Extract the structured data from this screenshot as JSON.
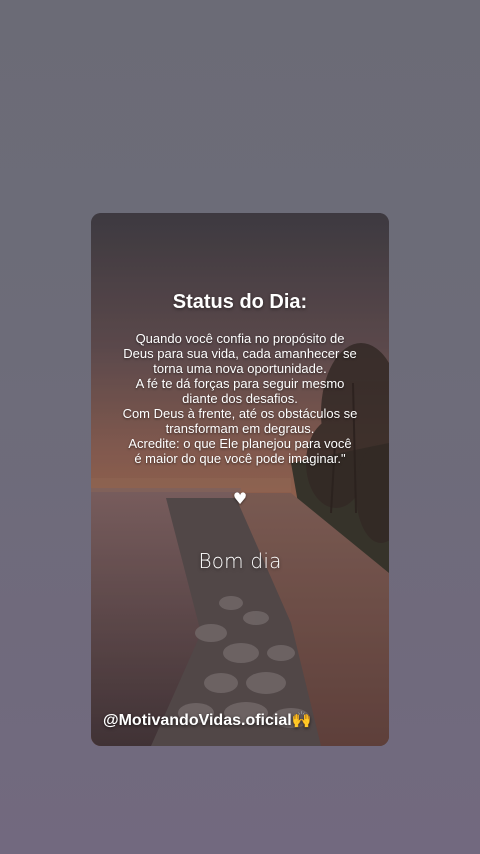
{
  "status_card": {
    "title": "Status do Dia:",
    "message_lines": [
      "Quando você confia no propósito de",
      "Deus para sua vida, cada amanhecer se",
      "torna uma nova oportunidade.",
      "A fé te dá forças para seguir mesmo",
      "diante dos desafios.",
      "Com Deus à frente, até os obstáculos se",
      "transformam em degraus.",
      "Acredite: o que Ele planejou para você",
      "é maior do que você pode imaginar.\""
    ],
    "heart_symbol": "♥",
    "greeting": "Bom dia",
    "handle": "@MotivandoVidas.oficial",
    "handle_emoji": "🙌"
  },
  "colors": {
    "background": "#6c6b77",
    "sky_top": "#4c4850",
    "sunset": "#8a6158",
    "text": "#ffffff"
  }
}
